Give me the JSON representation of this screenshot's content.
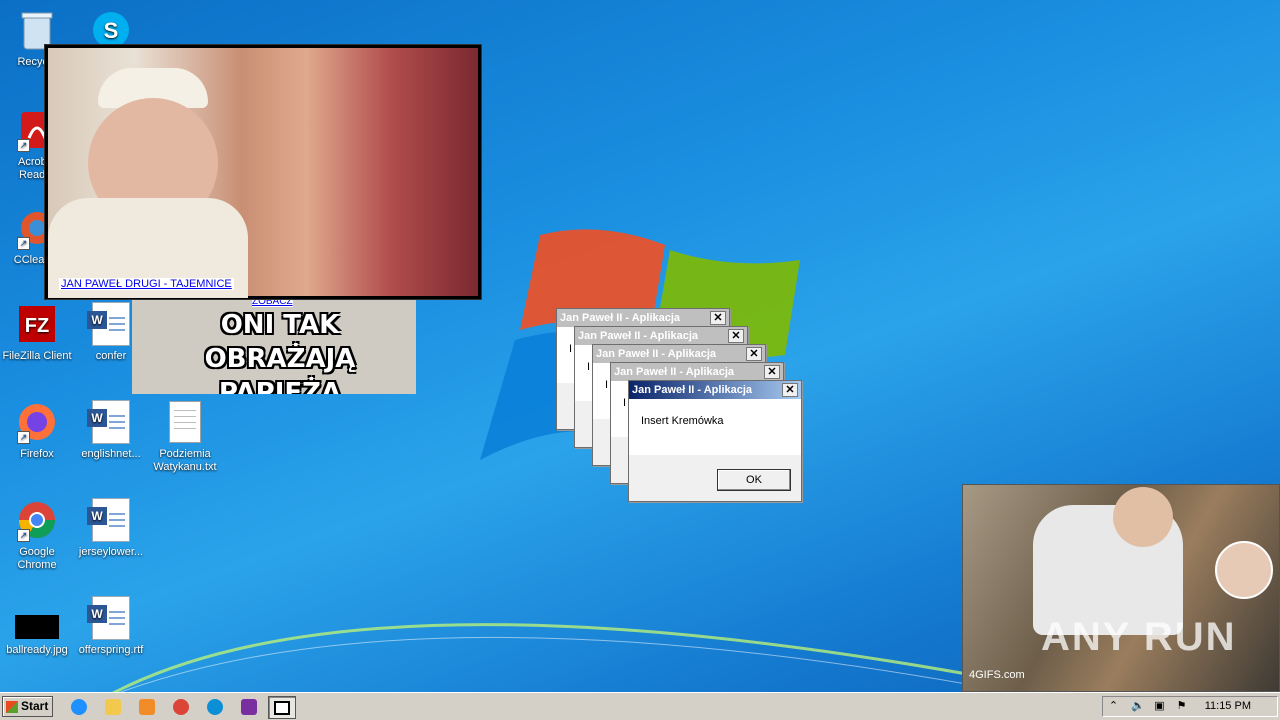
{
  "desktop": {
    "icons": [
      {
        "label": "Recycle",
        "icon": "recycle-bin-icon"
      },
      {
        "label": "Acrobat Reader",
        "icon": "acrobat-reader-icon"
      },
      {
        "label": "CCleaner",
        "icon": "ccleaner-icon"
      },
      {
        "label": "FileZilla Client",
        "icon": "filezilla-icon"
      },
      {
        "label": "confer",
        "icon": "word-document-icon"
      },
      {
        "label": "Firefox",
        "icon": "firefox-icon"
      },
      {
        "label": "englishnet...",
        "icon": "word-document-icon"
      },
      {
        "label": "Podziemia Watykanu.txt",
        "icon": "text-file-icon"
      },
      {
        "label": "Google Chrome",
        "icon": "chrome-icon"
      },
      {
        "label": "jerseylower...",
        "icon": "word-document-icon"
      },
      {
        "label": "ballready.jpg",
        "icon": "image-file-icon"
      },
      {
        "label": "offerspring.rtf",
        "icon": "word-document-icon"
      },
      {
        "label": "",
        "icon": "skype-icon"
      }
    ]
  },
  "popups": {
    "image1_caption": "JAN PAWEŁ DRUGI - TAJEMNICE",
    "image2_text_line1": "ONI TAK OBRAŻAJĄ",
    "image2_text_line2": "PAPIEŻA",
    "image2_link": "ZOBACZ",
    "image3_watermark": "ANY RUN",
    "image3_source": "4GIFS.com"
  },
  "dialogs": [
    {
      "title": "Jan Paweł II - Aplikacja",
      "message": "I",
      "state": "inactive"
    },
    {
      "title": "Jan Paweł II - Aplikacja",
      "message": "I",
      "state": "inactive"
    },
    {
      "title": "Jan Paweł II - Aplikacja",
      "message": "I",
      "state": "inactive"
    },
    {
      "title": "Jan Paweł II - Aplikacja",
      "message": "I",
      "state": "inactive"
    },
    {
      "title": "Jan Paweł II - Aplikacja",
      "message": "Insert Kremówka",
      "ok_label": "OK",
      "state": "active"
    }
  ],
  "taskbar": {
    "start_label": "Start",
    "pinned": [
      "internet-explorer-icon",
      "folder-icon",
      "media-player-icon",
      "chrome-icon",
      "edge-icon",
      "winrar-icon",
      "window-icon"
    ],
    "clock": "11:15 PM"
  },
  "colors": {
    "active_title_start": "#0a246a",
    "active_title_end": "#a6caf0",
    "inactive_title": "#bfbfbf",
    "taskbar": "#d4d0c8"
  }
}
